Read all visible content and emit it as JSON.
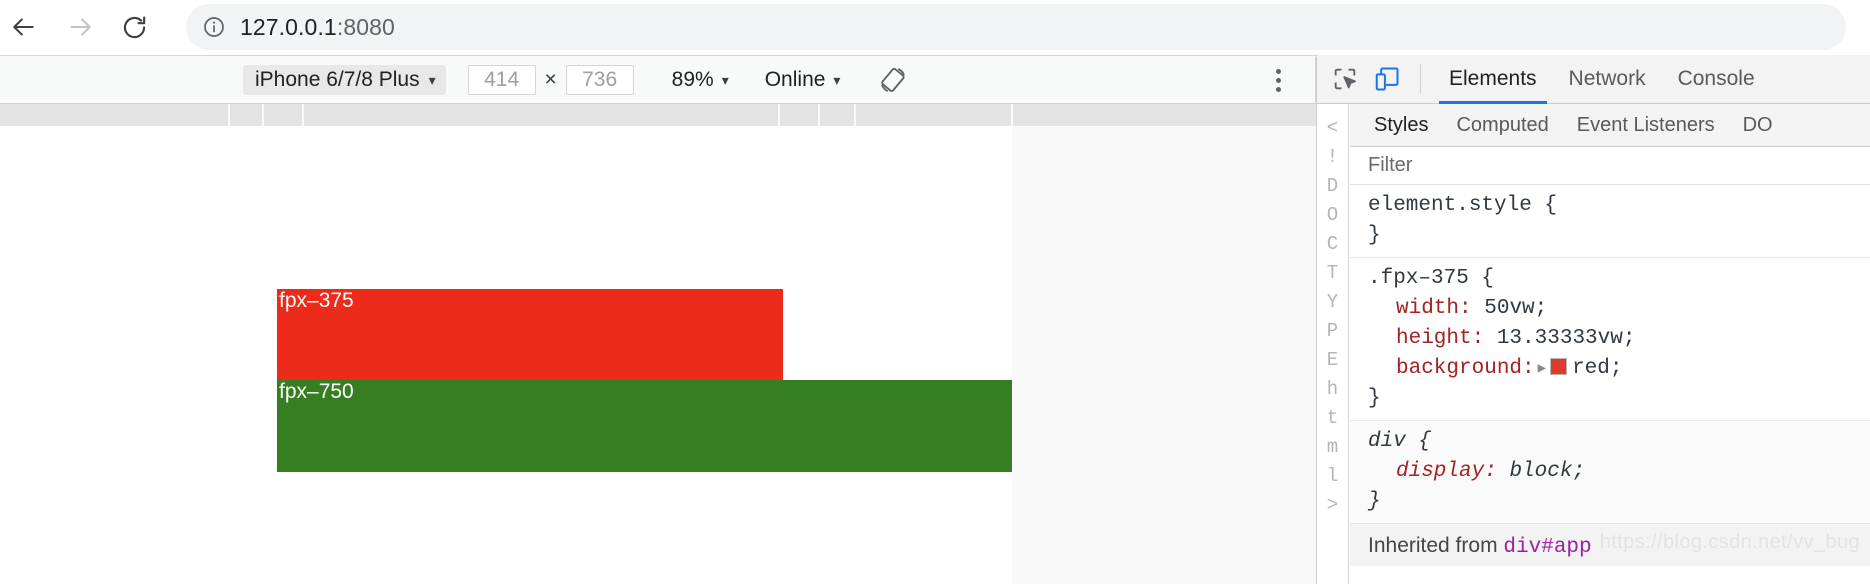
{
  "browser": {
    "back_icon": "arrow-left-icon",
    "forward_icon": "arrow-right-icon",
    "reload_icon": "reload-icon",
    "info_icon": "info-circle-icon",
    "url_host": "127.0.0.1",
    "url_port": ":8080"
  },
  "device_toolbar": {
    "device_label": "iPhone 6/7/8 Plus",
    "caret": "▾",
    "width_value": "414",
    "times": "×",
    "height_value": "736",
    "zoom_label": "89%",
    "throttle_label": "Online",
    "rotate_icon": "rotate-device-icon",
    "kebab_icon": "more-options-icon"
  },
  "page": {
    "box_red_label": "fpx–375",
    "box_green_label": "fpx–750",
    "red_color": "#ec2b1a",
    "green_color": "#357f20"
  },
  "devtools": {
    "inspect_icon": "inspect-element-icon",
    "device_toggle_icon": "toggle-device-toolbar-icon",
    "tabs": [
      {
        "label": "Elements",
        "active": true
      },
      {
        "label": "Network",
        "active": false
      },
      {
        "label": "Console",
        "active": false
      }
    ],
    "dom_sliver": [
      "<",
      "!",
      "D",
      "O",
      "C",
      "T",
      "Y",
      "P",
      "E",
      "h",
      "t",
      "m",
      "l",
      ">"
    ],
    "styles_tabs": [
      {
        "label": "Styles",
        "active": true
      },
      {
        "label": "Computed",
        "active": false
      },
      {
        "label": "Event Listeners",
        "active": false
      },
      {
        "label": "DO",
        "active": false
      }
    ],
    "filter_placeholder": "Filter",
    "rules": [
      {
        "selector": "element.style {",
        "close": "}",
        "declarations": []
      },
      {
        "selector": ".fpx–375 {",
        "close": "}",
        "declarations": [
          {
            "prop": "width:",
            "value": "50vw;",
            "swatch": null
          },
          {
            "prop": "height:",
            "value": "13.33333vw;",
            "swatch": null
          },
          {
            "prop": "background:",
            "value": "red;",
            "swatch": "#e03a2a"
          }
        ]
      },
      {
        "selector": "div {",
        "close": "}",
        "italic": true,
        "declarations": [
          {
            "prop": "display:",
            "value": "block;",
            "swatch": null
          }
        ]
      }
    ],
    "inherited_label": "Inherited from ",
    "inherited_target": "div#app"
  },
  "watermark": "https://blog.csdn.net/vv_bug"
}
